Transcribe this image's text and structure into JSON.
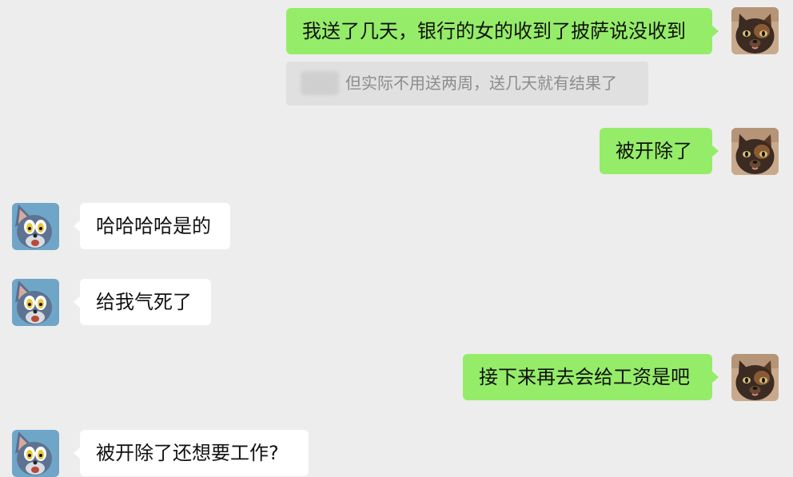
{
  "messages": [
    {
      "side": "right",
      "text": "我送了几天，银行的女的收到了披萨说没收到",
      "avatar_icon": "tortoiseshell-cat-avatar-icon"
    },
    {
      "side": "right",
      "text": "被开除了",
      "avatar_icon": "tortoiseshell-cat-avatar-icon"
    },
    {
      "side": "left",
      "text": "哈哈哈哈是的",
      "avatar_icon": "tom-cat-avatar-icon"
    },
    {
      "side": "left",
      "text": "给我气死了",
      "avatar_icon": "tom-cat-avatar-icon"
    },
    {
      "side": "right",
      "text": "接下来再去会给工资是吧",
      "avatar_icon": "tortoiseshell-cat-avatar-icon"
    },
    {
      "side": "left",
      "text": "被开除了还想要工作?",
      "avatar_icon": "tom-cat-avatar-icon"
    }
  ],
  "quote": {
    "text": "但实际不用送两周，送几天就有结果了"
  },
  "colors": {
    "background": "#ededed",
    "sent_bubble": "#95ec69",
    "received_bubble": "#ffffff",
    "quote_bg": "#e0e0e0",
    "quote_text": "#8c8c8c"
  }
}
